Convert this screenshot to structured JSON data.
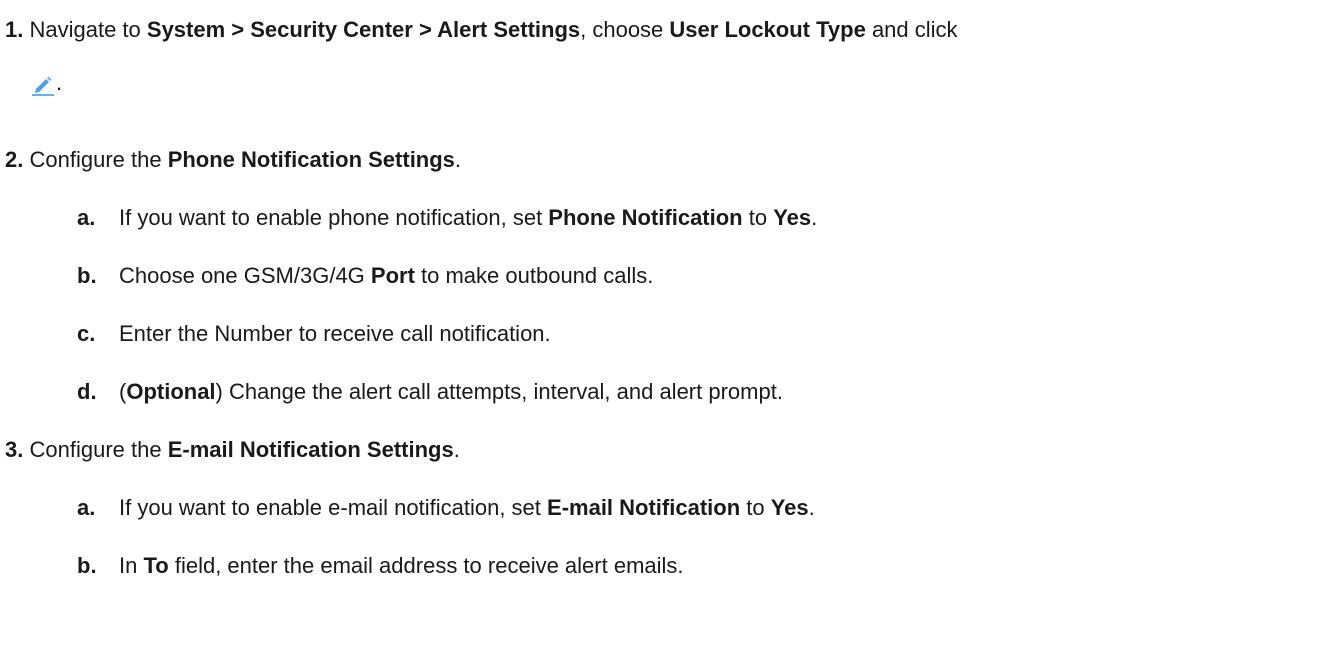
{
  "steps": [
    {
      "number": "1.",
      "parts": [
        {
          "t": "Navigate to ",
          "b": false
        },
        {
          "t": "System > Security Center > Alert Settings",
          "b": true
        },
        {
          "t": ", choose ",
          "b": false
        },
        {
          "t": "User Lockout Type",
          "b": true
        },
        {
          "t": " and click",
          "b": false
        }
      ],
      "continuation_after_icon": ".",
      "icon": "pencil-edit-icon"
    },
    {
      "number": "2.",
      "parts": [
        {
          "t": "Configure the ",
          "b": false
        },
        {
          "t": "Phone Notification Settings",
          "b": true
        },
        {
          "t": ".",
          "b": false
        }
      ],
      "substeps": [
        {
          "letter": "a.",
          "parts": [
            {
              "t": "If you want to enable phone notification, set ",
              "b": false
            },
            {
              "t": "Phone Notification",
              "b": true
            },
            {
              "t": " to ",
              "b": false
            },
            {
              "t": "Yes",
              "b": true
            },
            {
              "t": ".",
              "b": false
            }
          ]
        },
        {
          "letter": "b.",
          "parts": [
            {
              "t": "Choose one GSM/3G/4G ",
              "b": false
            },
            {
              "t": "Port",
              "b": true
            },
            {
              "t": " to make outbound calls.",
              "b": false
            }
          ]
        },
        {
          "letter": "c.",
          "parts": [
            {
              "t": "Enter the Number to receive call notification.",
              "b": false
            }
          ]
        },
        {
          "letter": "d.",
          "parts": [
            {
              "t": "(",
              "b": false
            },
            {
              "t": "Optional",
              "b": true
            },
            {
              "t": ") Change the alert call attempts, interval, and alert prompt.",
              "b": false
            }
          ]
        }
      ]
    },
    {
      "number": "3.",
      "parts": [
        {
          "t": "Configure the ",
          "b": false
        },
        {
          "t": "E-mail Notification Settings",
          "b": true
        },
        {
          "t": ".",
          "b": false
        }
      ],
      "substeps": [
        {
          "letter": "a.",
          "parts": [
            {
              "t": "If you want to enable e-mail notification, set ",
              "b": false
            },
            {
              "t": "E-mail Notification",
              "b": true
            },
            {
              "t": " to ",
              "b": false
            },
            {
              "t": "Yes",
              "b": true
            },
            {
              "t": ".",
              "b": false
            }
          ]
        },
        {
          "letter": "b.",
          "parts": [
            {
              "t": "In ",
              "b": false
            },
            {
              "t": "To",
              "b": true
            },
            {
              "t": " field, enter the email address to receive alert emails.",
              "b": false
            }
          ]
        }
      ]
    }
  ],
  "colors": {
    "text": "#1a1a1a",
    "icon_pencil": "#2f8fe6",
    "icon_underline": "#5cb3f5"
  }
}
